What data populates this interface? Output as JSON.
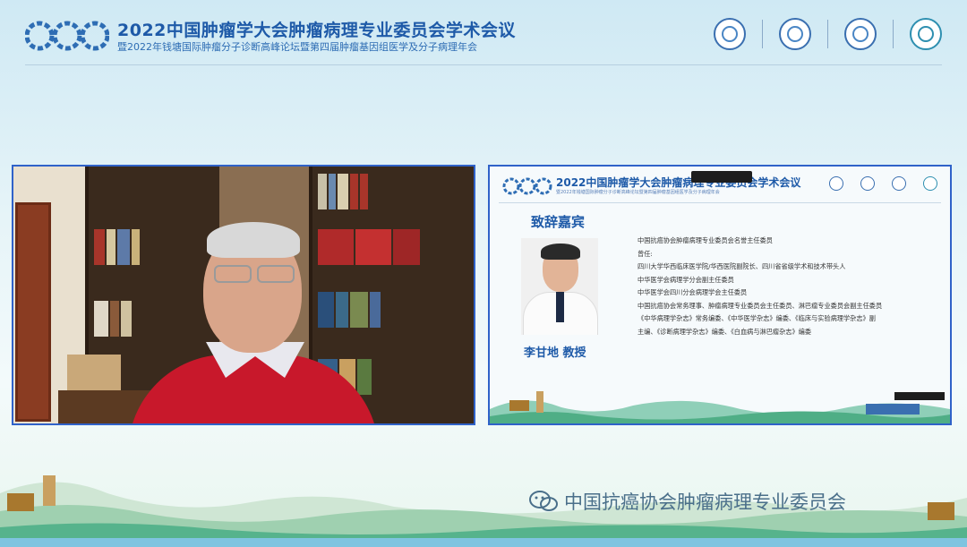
{
  "header": {
    "logo_text": "CCO",
    "title": "2022中国肿瘤学大会肿瘤病理专业委员会学术会议",
    "subtitle": "暨2022年钱塘国际肿瘤分子诊断高峰论坛暨第四届肿瘤基因组医学及分子病理年会",
    "logos": [
      "institution-logo-1",
      "institution-logo-2",
      "institution-logo-3",
      "institution-logo-4"
    ]
  },
  "slide": {
    "title": "2022中国肿瘤学大会肿瘤病理专业委员会学术会议",
    "subtitle": "暨2022年钱塘国际肿瘤分子诊断高峰论坛暨第四届肿瘤基因组医学及分子病理年会",
    "heading": "致辞嘉宾",
    "speaker_name": "李甘地 教授",
    "bio": [
      "中国抗癌协会肿瘤病理专业委员会名誉主任委员",
      "曾任:",
      "四川大学华西临床医学院/华西医院副院长、四川省省级学术和技术带头人",
      "中华医学会病理学分会副主任委员",
      "中华医学会四川分会病理学会主任委员",
      "中国抗癌协会常务理事、肿瘤病理专业委员会主任委员、淋巴瘤专业委员会副主任委员",
      "《中华病理学杂志》常务编委、《中华医学杂志》编委、《临床与实验病理学杂志》副",
      "主编、《诊断病理学杂志》编委、《白血病与淋巴瘤杂志》编委"
    ]
  },
  "watermark": {
    "text": "中国抗癌协会肿瘤病理专业委员会"
  },
  "colors": {
    "title_blue": "#1e5aa8",
    "pane_border": "#2f62c9"
  }
}
